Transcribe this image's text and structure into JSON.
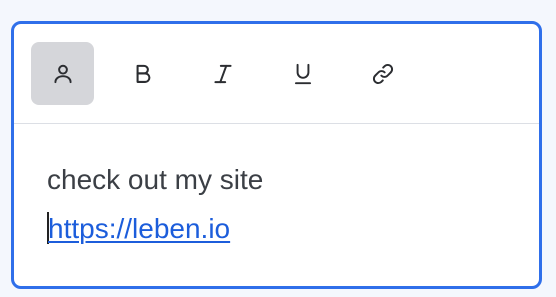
{
  "toolbar": {
    "buttons": [
      {
        "icon": "user-icon",
        "active": true
      },
      {
        "icon": "bold-icon",
        "active": false
      },
      {
        "icon": "italic-icon",
        "active": false
      },
      {
        "icon": "underline-icon",
        "active": false
      },
      {
        "icon": "link-icon",
        "active": false
      }
    ]
  },
  "content": {
    "line1": "check out my site",
    "link_text": "https://leben.io"
  },
  "colors": {
    "border": "#2f6fea",
    "link": "#1c5ddb",
    "active_button_bg": "#d5d6da"
  }
}
